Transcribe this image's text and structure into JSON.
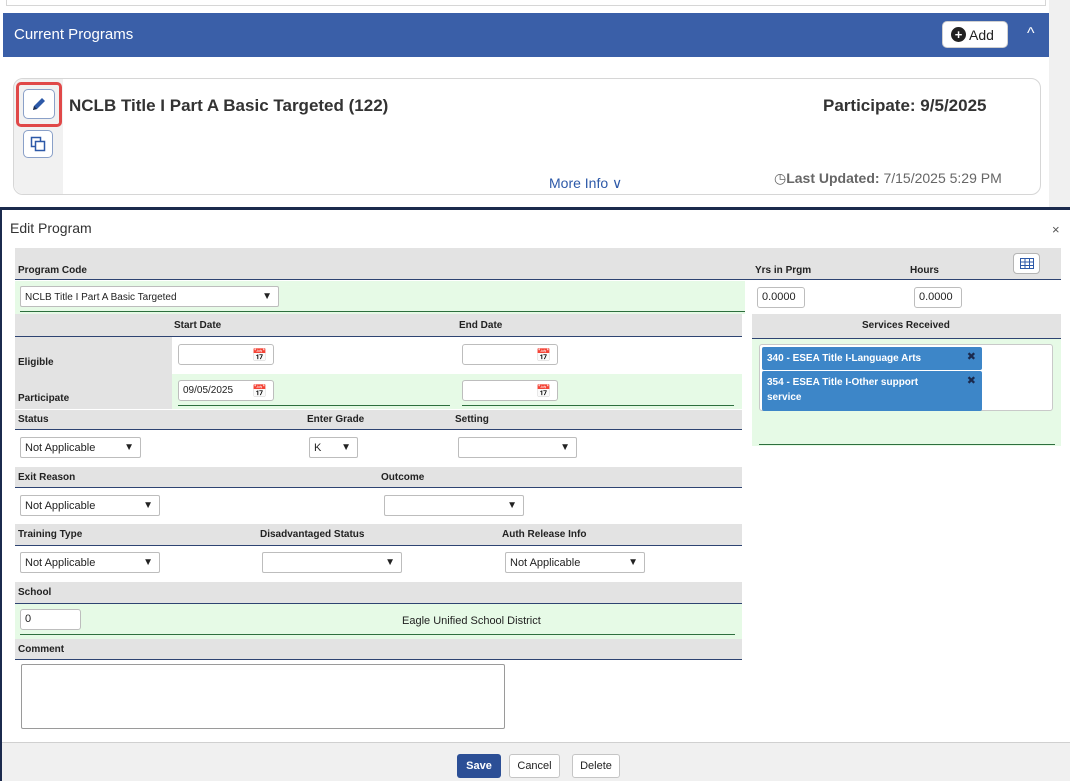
{
  "programs": {
    "header": "Current Programs",
    "add_label": "Add",
    "collapse_icon": "^",
    "card": {
      "name": "NCLB Title I Part A Basic Targeted (122)",
      "participate": "Participate: 9/5/2025",
      "more_info": "More Info ∨",
      "last_updated_label": "Last Updated:",
      "last_updated_value": " 7/15/2025 5:29 PM"
    }
  },
  "modal": {
    "title": "Edit Program",
    "close": "×",
    "program_code_label": "Program Code",
    "program_code_value": "NCLB Title I Part A Basic Targeted",
    "yrs_label": "Yrs in Prgm",
    "yrs_value": "0.0000",
    "hours_label": "Hours",
    "hours_value": "0.0000",
    "start_date_label": "Start Date",
    "end_date_label": "End Date",
    "eligible_label": "Eligible",
    "participate_label": "Participate",
    "participate_start": "09/05/2025",
    "services_label": "Services Received",
    "services": [
      "340 - ESEA Title I-Language Arts",
      "354 - ESEA Title I-Other support service"
    ],
    "status_label": "Status",
    "status_value": "Not Applicable",
    "enter_grade_label": "Enter Grade",
    "enter_grade_value": "K",
    "setting_label": "Setting",
    "setting_value": "",
    "exit_reason_label": "Exit Reason",
    "exit_reason_value": "Not Applicable",
    "outcome_label": "Outcome",
    "outcome_value": "",
    "training_type_label": "Training Type",
    "training_type_value": "Not Applicable",
    "disadvantaged_label": "Disadvantaged Status",
    "disadvantaged_value": "",
    "auth_release_label": "Auth Release Info",
    "auth_release_value": "Not Applicable",
    "school_label": "School",
    "school_value": "0",
    "school_name": "Eagle Unified School District",
    "comment_label": "Comment",
    "comment_value": "",
    "save_label": "Save",
    "cancel_label": "Cancel",
    "delete_label": "Delete"
  },
  "colors": {
    "header_blue": "#3a5fa8",
    "tag_blue": "#3d86c8",
    "save_blue": "#2c4f96",
    "highlight_red": "#e04848",
    "green_row": "#e6fae6"
  }
}
